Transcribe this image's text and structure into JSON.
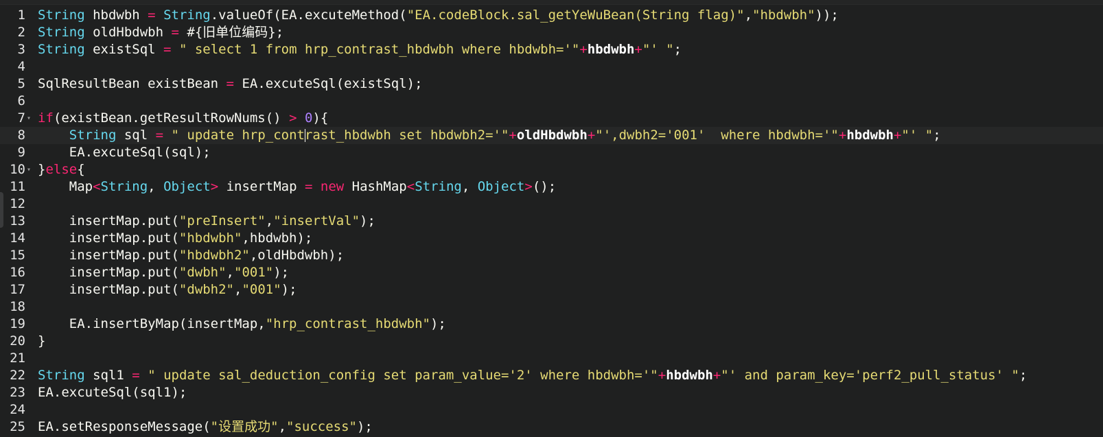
{
  "editor": {
    "colors": {
      "background": "#1f2020",
      "type": "#66d9ef",
      "keyword": "#f92672",
      "string": "#e6db74",
      "number": "#ae81ff",
      "plain": "#f8f8f2"
    },
    "active_line": 8,
    "fold_lines": [
      7,
      10
    ],
    "lines": [
      {
        "n": "1",
        "tokens": [
          {
            "t": "String",
            "c": "type"
          },
          {
            "t": " hbdwbh ",
            "c": "plain"
          },
          {
            "t": "=",
            "c": "op"
          },
          {
            "t": " ",
            "c": "plain"
          },
          {
            "t": "String",
            "c": "type"
          },
          {
            "t": ".valueOf(EA.excuteMethod(",
            "c": "plain"
          },
          {
            "t": "\"EA.codeBlock.sal_getYeWuBean(String flag)\"",
            "c": "str"
          },
          {
            "t": ",",
            "c": "plain"
          },
          {
            "t": "\"hbdwbh\"",
            "c": "str"
          },
          {
            "t": "));",
            "c": "plain"
          }
        ]
      },
      {
        "n": "2",
        "tokens": [
          {
            "t": "String",
            "c": "type"
          },
          {
            "t": " oldHbdwbh ",
            "c": "plain"
          },
          {
            "t": "=",
            "c": "op"
          },
          {
            "t": " #{旧单位编码};",
            "c": "plain"
          }
        ]
      },
      {
        "n": "3",
        "tokens": [
          {
            "t": "String",
            "c": "type"
          },
          {
            "t": " existSql ",
            "c": "plain"
          },
          {
            "t": "=",
            "c": "op"
          },
          {
            "t": " ",
            "c": "plain"
          },
          {
            "t": "\" select 1 from hrp_contrast_hbdwbh where hbdwbh='\"",
            "c": "str"
          },
          {
            "t": "+",
            "c": "op"
          },
          {
            "t": "hbdwbh",
            "c": "bold"
          },
          {
            "t": "+",
            "c": "op"
          },
          {
            "t": "\"' \"",
            "c": "str"
          },
          {
            "t": ";",
            "c": "plain"
          }
        ]
      },
      {
        "n": "4",
        "tokens": []
      },
      {
        "n": "5",
        "tokens": [
          {
            "t": "SqlResultBean existBean ",
            "c": "plain"
          },
          {
            "t": "=",
            "c": "op"
          },
          {
            "t": " EA.excuteSql(existSql);",
            "c": "plain"
          }
        ]
      },
      {
        "n": "6",
        "tokens": []
      },
      {
        "n": "7",
        "tokens": [
          {
            "t": "if",
            "c": "kw"
          },
          {
            "t": "(existBean.getResultRowNums() ",
            "c": "plain"
          },
          {
            "t": ">",
            "c": "op"
          },
          {
            "t": " ",
            "c": "plain"
          },
          {
            "t": "0",
            "c": "num"
          },
          {
            "t": "){",
            "c": "plain"
          }
        ]
      },
      {
        "n": "8",
        "tokens": [
          {
            "t": "    ",
            "c": "plain"
          },
          {
            "t": "String",
            "c": "type"
          },
          {
            "t": " sql ",
            "c": "plain"
          },
          {
            "t": "=",
            "c": "op"
          },
          {
            "t": " ",
            "c": "plain"
          },
          {
            "t": "\" update hrp_contrast_hbdwbh set hbdwbh2='\"",
            "c": "str"
          },
          {
            "t": "+",
            "c": "op"
          },
          {
            "t": "oldHbdwbh",
            "c": "bold"
          },
          {
            "t": "+",
            "c": "op"
          },
          {
            "t": "\"',dwbh2='001'  where hbdwbh='\"",
            "c": "str"
          },
          {
            "t": "+",
            "c": "op"
          },
          {
            "t": "hbdwbh",
            "c": "bold"
          },
          {
            "t": "+",
            "c": "op"
          },
          {
            "t": "\"' \"",
            "c": "str"
          },
          {
            "t": ";",
            "c": "plain"
          }
        ]
      },
      {
        "n": "9",
        "tokens": [
          {
            "t": "    EA.excuteSql(sql);",
            "c": "plain"
          }
        ]
      },
      {
        "n": "10",
        "tokens": [
          {
            "t": "}",
            "c": "plain"
          },
          {
            "t": "else",
            "c": "kw"
          },
          {
            "t": "{",
            "c": "plain"
          }
        ]
      },
      {
        "n": "11",
        "tokens": [
          {
            "t": "    Map",
            "c": "plain"
          },
          {
            "t": "<",
            "c": "op"
          },
          {
            "t": "String",
            "c": "type"
          },
          {
            "t": ", ",
            "c": "plain"
          },
          {
            "t": "Object",
            "c": "type"
          },
          {
            "t": ">",
            "c": "op"
          },
          {
            "t": " insertMap ",
            "c": "plain"
          },
          {
            "t": "=",
            "c": "op"
          },
          {
            "t": " ",
            "c": "plain"
          },
          {
            "t": "new",
            "c": "kw"
          },
          {
            "t": " HashMap",
            "c": "plain"
          },
          {
            "t": "<",
            "c": "op"
          },
          {
            "t": "String",
            "c": "type"
          },
          {
            "t": ", ",
            "c": "plain"
          },
          {
            "t": "Object",
            "c": "type"
          },
          {
            "t": ">",
            "c": "op"
          },
          {
            "t": "();",
            "c": "plain"
          }
        ]
      },
      {
        "n": "12",
        "tokens": []
      },
      {
        "n": "13",
        "tokens": [
          {
            "t": "    insertMap.put(",
            "c": "plain"
          },
          {
            "t": "\"preInsert\"",
            "c": "str"
          },
          {
            "t": ",",
            "c": "plain"
          },
          {
            "t": "\"insertVal\"",
            "c": "str"
          },
          {
            "t": ");",
            "c": "plain"
          }
        ]
      },
      {
        "n": "14",
        "tokens": [
          {
            "t": "    insertMap.put(",
            "c": "plain"
          },
          {
            "t": "\"hbdwbh\"",
            "c": "str"
          },
          {
            "t": ",hbdwbh);",
            "c": "plain"
          }
        ]
      },
      {
        "n": "15",
        "tokens": [
          {
            "t": "    insertMap.put(",
            "c": "plain"
          },
          {
            "t": "\"hbdwbh2\"",
            "c": "str"
          },
          {
            "t": ",oldHbdwbh);",
            "c": "plain"
          }
        ]
      },
      {
        "n": "16",
        "tokens": [
          {
            "t": "    insertMap.put(",
            "c": "plain"
          },
          {
            "t": "\"dwbh\"",
            "c": "str"
          },
          {
            "t": ",",
            "c": "plain"
          },
          {
            "t": "\"001\"",
            "c": "str"
          },
          {
            "t": ");",
            "c": "plain"
          }
        ]
      },
      {
        "n": "17",
        "tokens": [
          {
            "t": "    insertMap.put(",
            "c": "plain"
          },
          {
            "t": "\"dwbh2\"",
            "c": "str"
          },
          {
            "t": ",",
            "c": "plain"
          },
          {
            "t": "\"001\"",
            "c": "str"
          },
          {
            "t": ");",
            "c": "plain"
          }
        ]
      },
      {
        "n": "18",
        "tokens": []
      },
      {
        "n": "19",
        "tokens": [
          {
            "t": "    EA.insertByMap(insertMap,",
            "c": "plain"
          },
          {
            "t": "\"hrp_contrast_hbdwbh\"",
            "c": "str"
          },
          {
            "t": ");",
            "c": "plain"
          }
        ]
      },
      {
        "n": "20",
        "tokens": [
          {
            "t": "}",
            "c": "plain"
          }
        ]
      },
      {
        "n": "21",
        "tokens": []
      },
      {
        "n": "22",
        "tokens": [
          {
            "t": "String",
            "c": "type"
          },
          {
            "t": " sql1 ",
            "c": "plain"
          },
          {
            "t": "=",
            "c": "op"
          },
          {
            "t": " ",
            "c": "plain"
          },
          {
            "t": "\" update sal_deduction_config set param_value='2' where hbdwbh='\"",
            "c": "str"
          },
          {
            "t": "+",
            "c": "op"
          },
          {
            "t": "hbdwbh",
            "c": "bold"
          },
          {
            "t": "+",
            "c": "op"
          },
          {
            "t": "\"' and param_key='perf2_pull_status' \"",
            "c": "str"
          },
          {
            "t": ";",
            "c": "plain"
          }
        ]
      },
      {
        "n": "23",
        "tokens": [
          {
            "t": "EA.excuteSql(sql1);",
            "c": "plain"
          }
        ]
      },
      {
        "n": "24",
        "tokens": []
      },
      {
        "n": "25",
        "tokens": [
          {
            "t": "EA.setResponseMessage(",
            "c": "plain"
          },
          {
            "t": "\"设置成功\"",
            "c": "str"
          },
          {
            "t": ",",
            "c": "plain"
          },
          {
            "t": "\"success\"",
            "c": "str"
          },
          {
            "t": ");",
            "c": "plain"
          }
        ]
      }
    ]
  }
}
